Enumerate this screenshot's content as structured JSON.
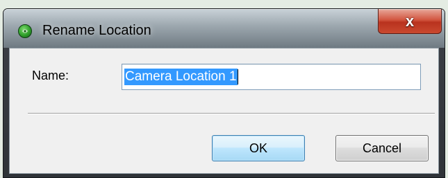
{
  "window": {
    "title": "Rename Location",
    "close_label": "x",
    "icon": "app-logo-icon"
  },
  "form": {
    "name_label": "Name:",
    "name_value": "Camera Location 1",
    "name_value_selected": true
  },
  "buttons": {
    "ok_label": "OK",
    "cancel_label": "Cancel"
  },
  "colors": {
    "selection": "#3399ff",
    "close_button": "#c9492f",
    "default_button": "#bee6fd"
  }
}
